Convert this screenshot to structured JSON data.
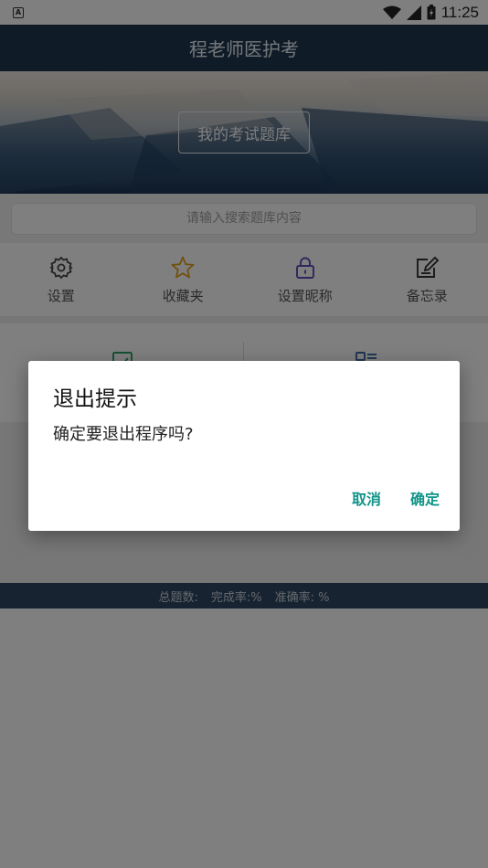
{
  "status_bar": {
    "notification_glyph": "A",
    "time": "11:25"
  },
  "app_bar": {
    "title": "程老师医护考"
  },
  "banner": {
    "button_label": "我的考试题库"
  },
  "search": {
    "placeholder": "请输入搜索题库内容"
  },
  "quick_actions": [
    {
      "label": "设置",
      "icon": "gear-icon",
      "color": "#444444"
    },
    {
      "label": "收藏夹",
      "icon": "star-icon",
      "color": "#e0a31e"
    },
    {
      "label": "设置昵称",
      "icon": "lock-icon",
      "color": "#5b4fb8"
    },
    {
      "label": "备忘录",
      "icon": "note-edit-icon",
      "color": "#333333"
    }
  ],
  "feature_icons": [
    {
      "icon": "checkbox-icon",
      "color": "#2e9e6a"
    },
    {
      "icon": "list-icon",
      "color": "#3b6aa0"
    }
  ],
  "stats_bar": {
    "total": "总题数:",
    "completion": "完成率:%",
    "accuracy": "准确率: %"
  },
  "dialog": {
    "title": "退出提示",
    "message": "确定要退出程序吗?",
    "cancel_label": "取消",
    "confirm_label": "确定",
    "accent_color": "#0f9488"
  }
}
